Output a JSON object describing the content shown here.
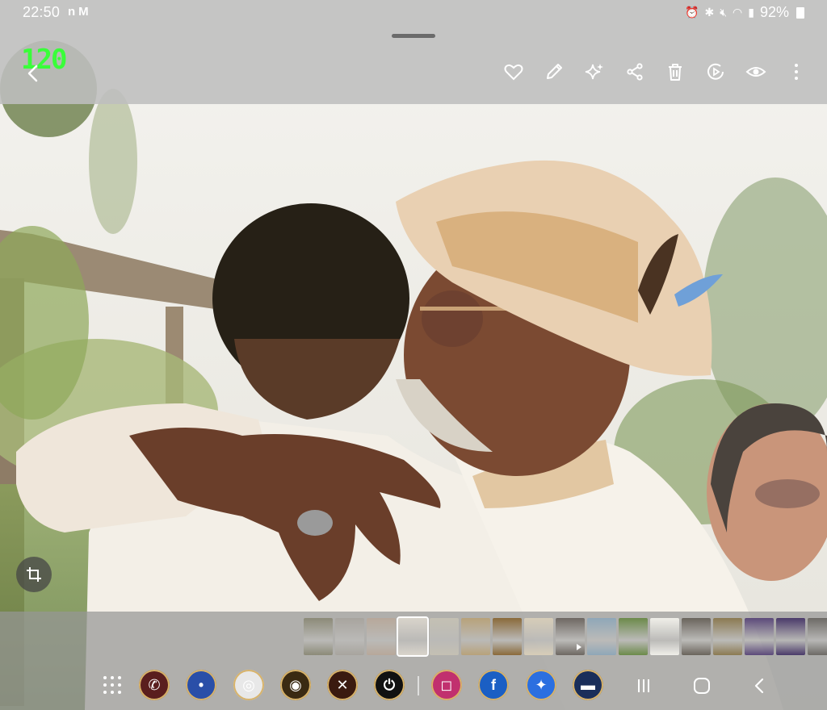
{
  "status_bar": {
    "time": "22:50",
    "left_icons": [
      "netflix-n-icon",
      "gmail-icon"
    ],
    "right_icons": [
      "alarm-icon",
      "bluetooth-icon",
      "mute-icon",
      "wifi-icon",
      "signal-icon"
    ],
    "battery_percent": "92%"
  },
  "overlay": {
    "fps_counter": "120"
  },
  "toolbar": {
    "icons": [
      "heart-icon",
      "edit-pencil-icon",
      "ai-sparkle-icon",
      "share-icon",
      "delete-trash-icon",
      "remaster-icon",
      "view-eye-icon",
      "more-options-icon"
    ]
  },
  "filmstrip": {
    "count": 17,
    "selected_index": 3,
    "video_index": 8,
    "colors": [
      "#8c8a78",
      "#a8a49e",
      "#b7a89a",
      "#d9d4cb",
      "#c4c0b3",
      "#b8a27a",
      "#8a6a3a",
      "#d7cdb8",
      "#6e6862",
      "#8fa7b8",
      "#6c8a4a",
      "#f0efe9",
      "#6a645c",
      "#8b7a52",
      "#5c4a7a",
      "#4a3a6a",
      "#6d6a66"
    ]
  },
  "dock": {
    "apps": [
      {
        "name": "phone-app-icon",
        "color": "#5a1e1e",
        "glyph": "✆"
      },
      {
        "name": "messages-app-icon",
        "color": "#2a4fa8",
        "glyph": "•"
      },
      {
        "name": "chrome-app-icon",
        "color": "#e8e8e8",
        "glyph": "◎"
      },
      {
        "name": "planet-app-icon",
        "color": "#3a2a12",
        "glyph": "◉"
      },
      {
        "name": "tools-app-icon",
        "color": "#3a1a10",
        "glyph": "✕"
      },
      {
        "name": "power-app-icon",
        "color": "#111111",
        "glyph": "⏻"
      },
      {
        "name": "instagram-app-icon",
        "color": "#c1306e",
        "glyph": "◻"
      },
      {
        "name": "facebook-app-icon",
        "color": "#1b5fc4",
        "glyph": "f"
      },
      {
        "name": "messenger-app-icon",
        "color": "#2b6fe0",
        "glyph": "✦"
      },
      {
        "name": "news-app-icon",
        "color": "#1a2e5a",
        "glyph": "▬"
      }
    ]
  }
}
